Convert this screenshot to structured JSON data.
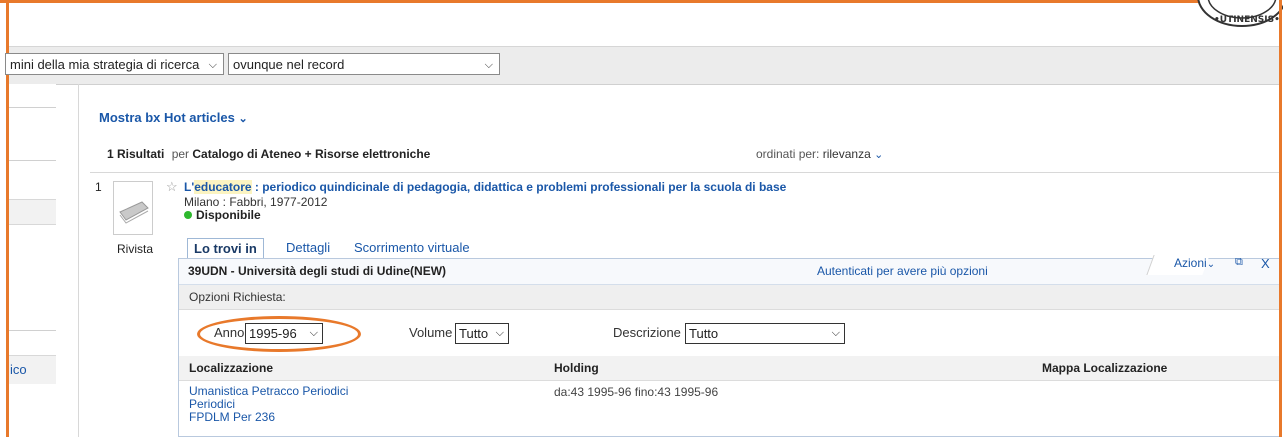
{
  "search": {
    "scope_select": "mini della mia strategia di ricerca",
    "field_select": "ovunque nel record"
  },
  "sidebar": {
    "partial_label": "ico"
  },
  "results": {
    "show_link": "Mostra bx Hot articles",
    "count": "1 Risultati",
    "per_label": "per",
    "scope": "Catalogo di Ateneo + Risorse elettroniche",
    "sort_label": "ordinati per:",
    "sort_value": "rilevanza"
  },
  "record": {
    "index": "1",
    "type_label": "Rivista",
    "title_pre": "L'",
    "title_highlight": "educatore",
    "title_post": " : periodico quindicinale di pedagogia, didattica e problemi professionali per la scuola di base",
    "publication": "Milano : Fabbri, 1977-2012",
    "availability": "Disponibile",
    "availability_color": "#2eb82e"
  },
  "tabs": [
    {
      "label": "Lo trovi in"
    },
    {
      "label": "Dettagli"
    },
    {
      "label": "Scorrimento virtuale"
    }
  ],
  "panel": {
    "library": "39UDN - Università degli studi di Udine(NEW)",
    "auth_link": "Autenticati per avere più opzioni",
    "actions": "Azioni",
    "close": "X",
    "options_label": "Opzioni Richiesta:",
    "filters": {
      "anno_label": "Anno",
      "anno_value": "1995-96",
      "volume_label": "Volume",
      "volume_value": "Tutto",
      "descr_label": "Descrizione",
      "descr_value": "Tutto"
    },
    "columns": [
      "Localizzazione",
      "Holding",
      "Mappa Localizzazione"
    ],
    "rows": [
      {
        "location": [
          "Umanistica Petracco Periodici",
          "Periodici",
          "FPDLM Per 236"
        ],
        "holding": "da:43 1995-96 fino:43 1995-96"
      }
    ]
  },
  "accent_color": "#e8792b",
  "link_color": "#1a57a8"
}
